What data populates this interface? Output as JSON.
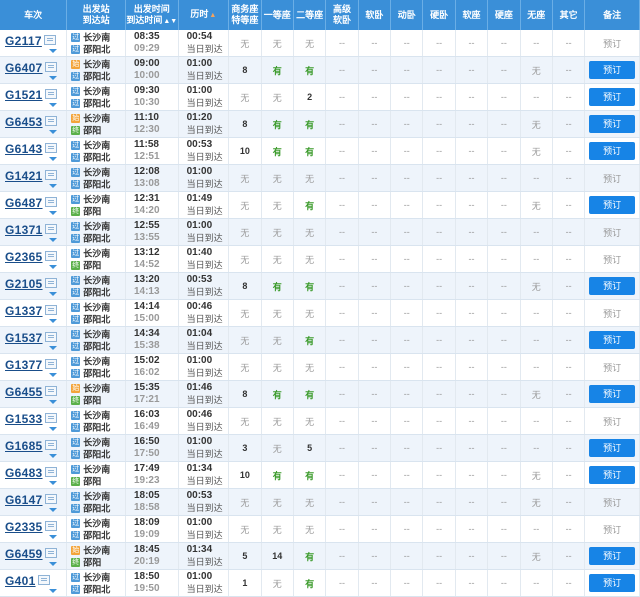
{
  "header": {
    "train": "车次",
    "station_from": "出发站",
    "station_to": "到达站",
    "time_dep": "出发时间",
    "time_arr": "到达时间",
    "duration": "历时",
    "business1": "商务座",
    "business2": "特等座",
    "first": "一等座",
    "second": "二等座",
    "premium1": "高级",
    "premium2": "软卧",
    "soft_sleeper": "软卧",
    "motion_sleeper": "动卧",
    "hard_sleeper": "硬卧",
    "soft_seat": "软座",
    "hard_seat": "硬座",
    "no_seat": "无座",
    "other": "其它",
    "remark": "备注",
    "sort_icon_dep": "sort-icon",
    "sort_icon_dur": "sort-icon"
  },
  "labels": {
    "book": "预订",
    "same_day": "当日到达"
  },
  "station_tags": {
    "start": "始",
    "pass": "过",
    "end": "终"
  },
  "colors": {
    "header_bg": "#3a8fd8",
    "book_btn": "#1784e6",
    "available": "#3a9a2a",
    "train_no": "#1a4e8a"
  },
  "rows": [
    {
      "train": "G2117",
      "from": "长沙南",
      "from_tag": "过",
      "to": "邵阳北",
      "to_tag": "过",
      "dep": "08:35",
      "arr": "09:29",
      "dur": "00:54",
      "same": "当日到达",
      "seats": [
        "无",
        "无",
        "无",
        "--",
        "--",
        "--",
        "--",
        "--",
        "--",
        "--",
        "--"
      ],
      "book": false
    },
    {
      "train": "G6407",
      "from": "长沙南",
      "from_tag": "始",
      "to": "邵阳北",
      "to_tag": "过",
      "dep": "09:00",
      "arr": "10:00",
      "dur": "01:00",
      "same": "当日到达",
      "seats": [
        "8",
        "有",
        "有",
        "--",
        "--",
        "--",
        "--",
        "--",
        "--",
        "无",
        "--"
      ],
      "book": true
    },
    {
      "train": "G1521",
      "from": "长沙南",
      "from_tag": "过",
      "to": "邵阳北",
      "to_tag": "过",
      "dep": "09:30",
      "arr": "10:30",
      "dur": "01:00",
      "same": "当日到达",
      "seats": [
        "无",
        "无",
        "2",
        "--",
        "--",
        "--",
        "--",
        "--",
        "--",
        "--",
        "--"
      ],
      "book": true
    },
    {
      "train": "G6453",
      "from": "长沙南",
      "from_tag": "始",
      "to": "邵阳",
      "to_tag": "终",
      "dep": "11:10",
      "arr": "12:30",
      "dur": "01:20",
      "same": "当日到达",
      "seats": [
        "8",
        "有",
        "有",
        "--",
        "--",
        "--",
        "--",
        "--",
        "--",
        "无",
        "--"
      ],
      "book": true
    },
    {
      "train": "G6143",
      "from": "长沙南",
      "from_tag": "过",
      "to": "邵阳北",
      "to_tag": "过",
      "dep": "11:58",
      "arr": "12:51",
      "dur": "00:53",
      "same": "当日到达",
      "seats": [
        "10",
        "有",
        "有",
        "--",
        "--",
        "--",
        "--",
        "--",
        "--",
        "无",
        "--"
      ],
      "book": true
    },
    {
      "train": "G1421",
      "from": "长沙南",
      "from_tag": "过",
      "to": "邵阳北",
      "to_tag": "过",
      "dep": "12:08",
      "arr": "13:08",
      "dur": "01:00",
      "same": "当日到达",
      "seats": [
        "无",
        "无",
        "无",
        "--",
        "--",
        "--",
        "--",
        "--",
        "--",
        "--",
        "--"
      ],
      "book": false
    },
    {
      "train": "G6487",
      "from": "长沙南",
      "from_tag": "过",
      "to": "邵阳",
      "to_tag": "终",
      "dep": "12:31",
      "arr": "14:20",
      "dur": "01:49",
      "same": "当日到达",
      "seats": [
        "无",
        "无",
        "有",
        "--",
        "--",
        "--",
        "--",
        "--",
        "--",
        "无",
        "--"
      ],
      "book": true
    },
    {
      "train": "G1371",
      "from": "长沙南",
      "from_tag": "过",
      "to": "邵阳北",
      "to_tag": "过",
      "dep": "12:55",
      "arr": "13:55",
      "dur": "01:00",
      "same": "当日到达",
      "seats": [
        "无",
        "无",
        "无",
        "--",
        "--",
        "--",
        "--",
        "--",
        "--",
        "--",
        "--"
      ],
      "book": false
    },
    {
      "train": "G2365",
      "from": "长沙南",
      "from_tag": "过",
      "to": "邵阳",
      "to_tag": "终",
      "dep": "13:12",
      "arr": "14:52",
      "dur": "01:40",
      "same": "当日到达",
      "seats": [
        "无",
        "无",
        "无",
        "--",
        "--",
        "--",
        "--",
        "--",
        "--",
        "--",
        "--"
      ],
      "book": false
    },
    {
      "train": "G2105",
      "from": "长沙南",
      "from_tag": "过",
      "to": "邵阳北",
      "to_tag": "过",
      "dep": "13:20",
      "arr": "14:13",
      "dur": "00:53",
      "same": "当日到达",
      "seats": [
        "8",
        "有",
        "有",
        "--",
        "--",
        "--",
        "--",
        "--",
        "--",
        "无",
        "--"
      ],
      "book": true
    },
    {
      "train": "G1337",
      "from": "长沙南",
      "from_tag": "过",
      "to": "邵阳北",
      "to_tag": "过",
      "dep": "14:14",
      "arr": "15:00",
      "dur": "00:46",
      "same": "当日到达",
      "seats": [
        "无",
        "无",
        "无",
        "--",
        "--",
        "--",
        "--",
        "--",
        "--",
        "--",
        "--"
      ],
      "book": false
    },
    {
      "train": "G1537",
      "from": "长沙南",
      "from_tag": "过",
      "to": "邵阳北",
      "to_tag": "过",
      "dep": "14:34",
      "arr": "15:38",
      "dur": "01:04",
      "same": "当日到达",
      "seats": [
        "无",
        "无",
        "有",
        "--",
        "--",
        "--",
        "--",
        "--",
        "--",
        "--",
        "--"
      ],
      "book": true
    },
    {
      "train": "G1377",
      "from": "长沙南",
      "from_tag": "过",
      "to": "邵阳北",
      "to_tag": "过",
      "dep": "15:02",
      "arr": "16:02",
      "dur": "01:00",
      "same": "当日到达",
      "seats": [
        "无",
        "无",
        "无",
        "--",
        "--",
        "--",
        "--",
        "--",
        "--",
        "--",
        "--"
      ],
      "book": false
    },
    {
      "train": "G6455",
      "from": "长沙南",
      "from_tag": "始",
      "to": "邵阳",
      "to_tag": "终",
      "dep": "15:35",
      "arr": "17:21",
      "dur": "01:46",
      "same": "当日到达",
      "seats": [
        "8",
        "有",
        "有",
        "--",
        "--",
        "--",
        "--",
        "--",
        "--",
        "无",
        "--"
      ],
      "book": true
    },
    {
      "train": "G1533",
      "from": "长沙南",
      "from_tag": "过",
      "to": "邵阳北",
      "to_tag": "过",
      "dep": "16:03",
      "arr": "16:49",
      "dur": "00:46",
      "same": "当日到达",
      "seats": [
        "无",
        "无",
        "无",
        "--",
        "--",
        "--",
        "--",
        "--",
        "--",
        "--",
        "--"
      ],
      "book": false
    },
    {
      "train": "G1685",
      "from": "长沙南",
      "from_tag": "过",
      "to": "邵阳北",
      "to_tag": "过",
      "dep": "16:50",
      "arr": "17:50",
      "dur": "01:00",
      "same": "当日到达",
      "seats": [
        "3",
        "无",
        "5",
        "--",
        "--",
        "--",
        "--",
        "--",
        "--",
        "--",
        "--"
      ],
      "book": true
    },
    {
      "train": "G6483",
      "from": "长沙南",
      "from_tag": "过",
      "to": "邵阳",
      "to_tag": "终",
      "dep": "17:49",
      "arr": "19:23",
      "dur": "01:34",
      "same": "当日到达",
      "seats": [
        "10",
        "有",
        "有",
        "--",
        "--",
        "--",
        "--",
        "--",
        "--",
        "无",
        "--"
      ],
      "book": true
    },
    {
      "train": "G6147",
      "from": "长沙南",
      "from_tag": "过",
      "to": "邵阳北",
      "to_tag": "过",
      "dep": "18:05",
      "arr": "18:58",
      "dur": "00:53",
      "same": "当日到达",
      "seats": [
        "无",
        "无",
        "无",
        "--",
        "--",
        "--",
        "--",
        "--",
        "--",
        "无",
        "--"
      ],
      "book": false
    },
    {
      "train": "G2335",
      "from": "长沙南",
      "from_tag": "过",
      "to": "邵阳北",
      "to_tag": "过",
      "dep": "18:09",
      "arr": "19:09",
      "dur": "01:00",
      "same": "当日到达",
      "seats": [
        "无",
        "无",
        "无",
        "--",
        "--",
        "--",
        "--",
        "--",
        "--",
        "--",
        "--"
      ],
      "book": false
    },
    {
      "train": "G6459",
      "from": "长沙南",
      "from_tag": "始",
      "to": "邵阳",
      "to_tag": "终",
      "dep": "18:45",
      "arr": "20:19",
      "dur": "01:34",
      "same": "当日到达",
      "seats": [
        "5",
        "14",
        "有",
        "--",
        "--",
        "--",
        "--",
        "--",
        "--",
        "无",
        "--"
      ],
      "book": true
    },
    {
      "train": "G401",
      "from": "长沙南",
      "from_tag": "过",
      "to": "邵阳北",
      "to_tag": "过",
      "dep": "18:50",
      "arr": "19:50",
      "dur": "01:00",
      "same": "当日到达",
      "seats": [
        "1",
        "无",
        "有",
        "--",
        "--",
        "--",
        "--",
        "--",
        "--",
        "--",
        "--"
      ],
      "book": true
    }
  ]
}
